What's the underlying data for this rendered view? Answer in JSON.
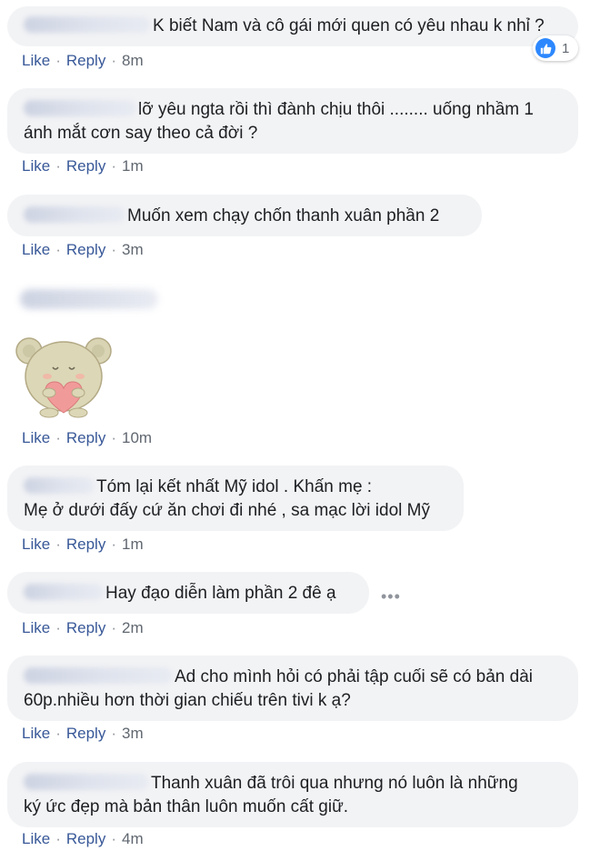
{
  "actions": {
    "like_label": "Like",
    "reply_label": "Reply",
    "separator": "·"
  },
  "comments": [
    {
      "lines": [
        "K biết Nam và cô gái mới quen có yêu nhau k nhỉ ?"
      ],
      "time": "8m",
      "reaction": {
        "type": "like",
        "count": "1"
      }
    },
    {
      "lines": [
        "lỡ yêu ngta rồi thì đành chịu thôi ........ uống nhầm 1",
        "ánh mắt cơn say theo cả đời ?"
      ],
      "time": "1m"
    },
    {
      "lines": [
        "Muốn xem chạy chốn thanh xuân phần 2"
      ],
      "time": "3m"
    },
    {
      "lines": [],
      "sticker": "bear-heart-sticker",
      "time": "10m"
    },
    {
      "lines": [
        "Tóm lại kết nhất Mỹ idol . Khấn mẹ :",
        "Mẹ ở dưới đấy cứ ăn chơi đi nhé , sa mạc lời idol Mỹ"
      ],
      "time": "1m"
    },
    {
      "lines": [
        "Hay đạo diễn làm phần 2 đê ạ"
      ],
      "time": "2m",
      "more_options": "•••"
    },
    {
      "lines": [
        "Ad cho mình hỏi có phải tập cuối sẽ có bản dài",
        "60p.nhiều hơn thời gian chiếu trên tivi k ạ?"
      ],
      "time": "3m"
    },
    {
      "lines": [
        "Thanh xuân đã trôi qua nhưng nó luôn là những",
        "ký ức đẹp mà bản thân luôn muốn cất giữ."
      ],
      "time": "4m"
    }
  ],
  "colors": {
    "bubble_bg": "#f2f3f5",
    "link": "#385898",
    "meta": "#606770",
    "like_blue": "#2d88ff"
  }
}
